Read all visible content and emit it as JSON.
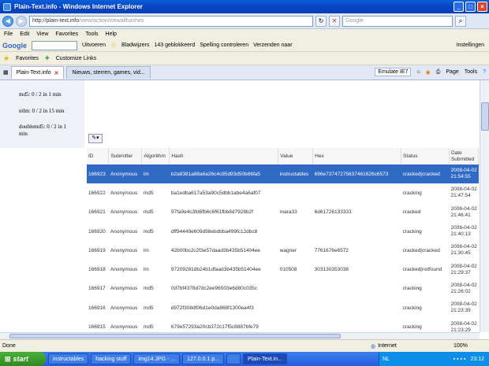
{
  "window": {
    "title": "Plain-Text.info - Windows Internet Explorer"
  },
  "address": {
    "host": "http://plain-text.info",
    "path": "/view/action/viewallhashes"
  },
  "search": {
    "placeholder": "Google"
  },
  "menu": [
    "File",
    "Edit",
    "View",
    "Favorites",
    "Tools",
    "Help"
  ],
  "google_toolbar": {
    "logo": "Google",
    "items": [
      "Uitvoeren",
      "Bladwijzers",
      "143 geblokkeerd",
      "Spelling controleren",
      "Verzenden naar",
      "Instellingen"
    ]
  },
  "favorites_bar": {
    "favorites": "Favorites",
    "links": "Customize Links"
  },
  "tabs": [
    {
      "label": "Plain-Text.info",
      "active": true
    },
    {
      "label": "Nieuws, sterren, games, vid...",
      "active": false
    }
  ],
  "ie_tools": {
    "emulate": "Emulate IE7",
    "page": "Page",
    "tools": "Tools"
  },
  "sidebar": [
    "md5: 0 / 2 in 1 min",
    "ntlm: 0 / 2 in 15 min",
    "doublemd5: 0 / 2 in 1",
    "min"
  ],
  "table": {
    "headers": [
      "ID",
      "Submitter",
      "Algorithm",
      "Hash",
      "Value",
      "Hex",
      "Status",
      "Date Submitted"
    ],
    "rows": [
      {
        "id": "166923",
        "submitter": "Anonymous",
        "algorithm": "lm",
        "hash": "b2a8381a88a6a26c4c85d93d50b86fa5",
        "value": "instructables",
        "hex": "696e73747275637461626c6573",
        "status": "cracked|cracked",
        "date": "2008-04-02 21:54:55",
        "selected": true
      },
      {
        "id": "166922",
        "submitter": "Anonymous",
        "algorithm": "md5",
        "hash": "ba1edba617a53a90c5dbb1abe4a6af07",
        "value": "",
        "hex": "",
        "status": "cracking",
        "date": "2008-04-02 21:47:54",
        "selected": false
      },
      {
        "id": "166921",
        "submitter": "Anonymous",
        "algorithm": "md5",
        "hash": "97fa9e4c3fd6fb6c6f61fbb8d7928b2f",
        "value": "mara33",
        "hex": "6d61726133333",
        "status": "cracked",
        "date": "2008-04-02 21:46:41",
        "selected": false
      },
      {
        "id": "166920",
        "submitter": "Anonymous",
        "algorithm": "md5",
        "hash": "dff94449e609d98ebdbba499fc12dbc8",
        "value": "",
        "hex": "",
        "status": "cracking",
        "date": "2008-04-02 21:40:13",
        "selected": false
      },
      {
        "id": "166919",
        "submitter": "Anonymous",
        "algorithm": "lm",
        "hash": "42b00bc2c2f3e57daad3b435b51404ee",
        "value": "wagner",
        "hex": "7761676e6572",
        "status": "cracked|cracked",
        "date": "2008-04-02 21:30:45",
        "selected": false
      },
      {
        "id": "166918",
        "submitter": "Anonymous",
        "algorithm": "lm",
        "hash": "97209281db24b1dfaad3b435b51404ee",
        "value": "010508",
        "hex": "303130353038",
        "status": "cracked|notfound",
        "date": "2008-04-02 21:29:37",
        "selected": false
      },
      {
        "id": "166917",
        "submitter": "Anonymous",
        "algorithm": "md5",
        "hash": "0d7bf4378d7dc2ee96503e6d80c035c",
        "value": "",
        "hex": "",
        "status": "cracking",
        "date": "2008-04-02 21:26:02",
        "selected": false
      },
      {
        "id": "166916",
        "submitter": "Anonymous",
        "algorithm": "md5",
        "hash": "d972f308df06d1e0da868f1300ea4f3",
        "value": "",
        "hex": "",
        "status": "cracking",
        "date": "2008-04-02 21:23:39",
        "selected": false
      },
      {
        "id": "166915",
        "submitter": "Anonymous",
        "algorithm": "md5",
        "hash": "679e57293a20cb372c17f5c8887bfe79",
        "value": "",
        "hex": "",
        "status": "cracking",
        "date": "2008-04-02 21:23:29",
        "selected": false
      }
    ]
  },
  "status_bar": {
    "left": "Done",
    "zone": "Internet",
    "zoom": "100%"
  },
  "taskbar": {
    "start": "start",
    "tasks": [
      "instructables",
      "hacking stuff",
      "img14.JPG - ...",
      "127.0.0.1 p...",
      "",
      "Plain-Text.in..."
    ],
    "tray_lang": "NL",
    "clock": "23:12"
  }
}
